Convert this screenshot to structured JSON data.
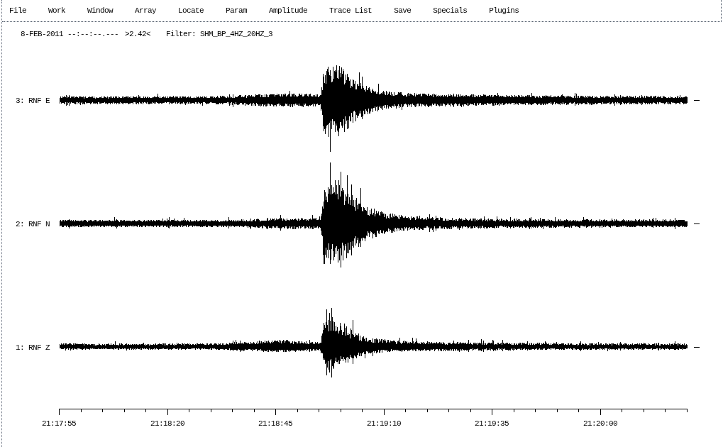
{
  "menu_bar": {
    "items": [
      "File",
      "Work",
      "Window",
      "Array",
      "Locate",
      "Param",
      "Amplitude",
      "Trace List",
      "Save",
      "Specials",
      "Plugins"
    ]
  },
  "header": {
    "datetime": "8-FEB-2011 --:--:--.---",
    "scale": ">2.42<",
    "filter": "Filter: SHM_BP_4HZ_20HZ_3"
  },
  "traces": [
    {
      "label": "3: RNF E"
    },
    {
      "label": "2: RNF N"
    },
    {
      "label": "1: RNF Z"
    }
  ],
  "time_axis": {
    "labels": [
      "21:17:55",
      "21:18:20",
      "21:18:45",
      "21:19:10",
      "21:19:35",
      "21:20:00"
    ]
  }
}
